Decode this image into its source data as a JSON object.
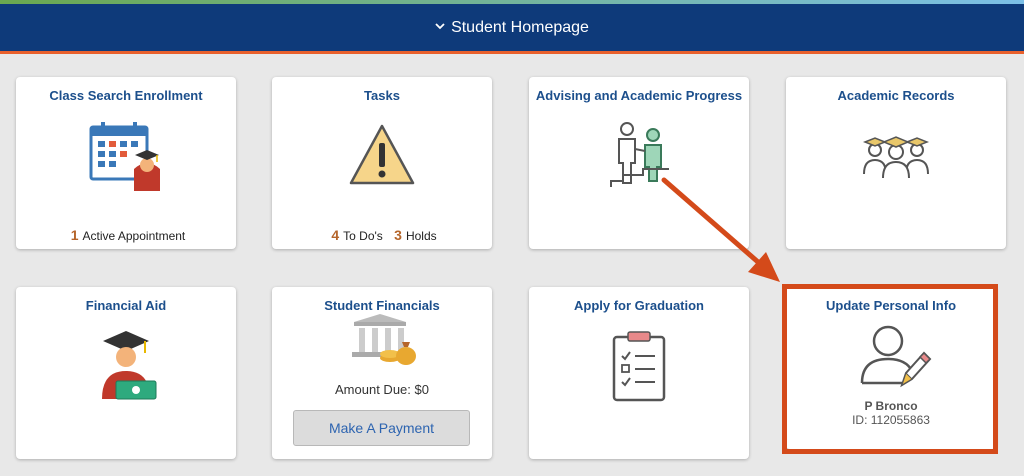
{
  "header": {
    "title": "Student Homepage"
  },
  "tiles": {
    "class_search": {
      "title": "Class Search Enrollment",
      "count": "1",
      "label": "Active Appointment"
    },
    "tasks": {
      "title": "Tasks",
      "todo_count": "4",
      "todo_label": "To Do's",
      "holds_count": "3",
      "holds_label": "Holds"
    },
    "advising": {
      "title": "Advising and Academic Progress"
    },
    "records": {
      "title": "Academic Records"
    },
    "financial_aid": {
      "title": "Financial Aid"
    },
    "student_financials": {
      "title": "Student Financials",
      "amount_due": "Amount Due: $0",
      "pay_button": "Make A Payment"
    },
    "graduation": {
      "title": "Apply for Graduation"
    },
    "personal_info": {
      "title": "Update Personal Info",
      "name": "P Bronco",
      "id_text": "ID: 112055863"
    }
  },
  "colors": {
    "header_bg": "#0e3a7a",
    "accent": "#e8602c",
    "title_blue": "#1c4f8c",
    "count": "#b5652a",
    "highlight": "#d44a1a"
  },
  "icons": [
    "chevron-down-icon",
    "calendar-student-icon",
    "warning-icon",
    "advising-handshake-icon",
    "graduates-group-icon",
    "graduate-money-icon",
    "bank-money-icon",
    "clipboard-checklist-icon",
    "user-edit-icon"
  ]
}
